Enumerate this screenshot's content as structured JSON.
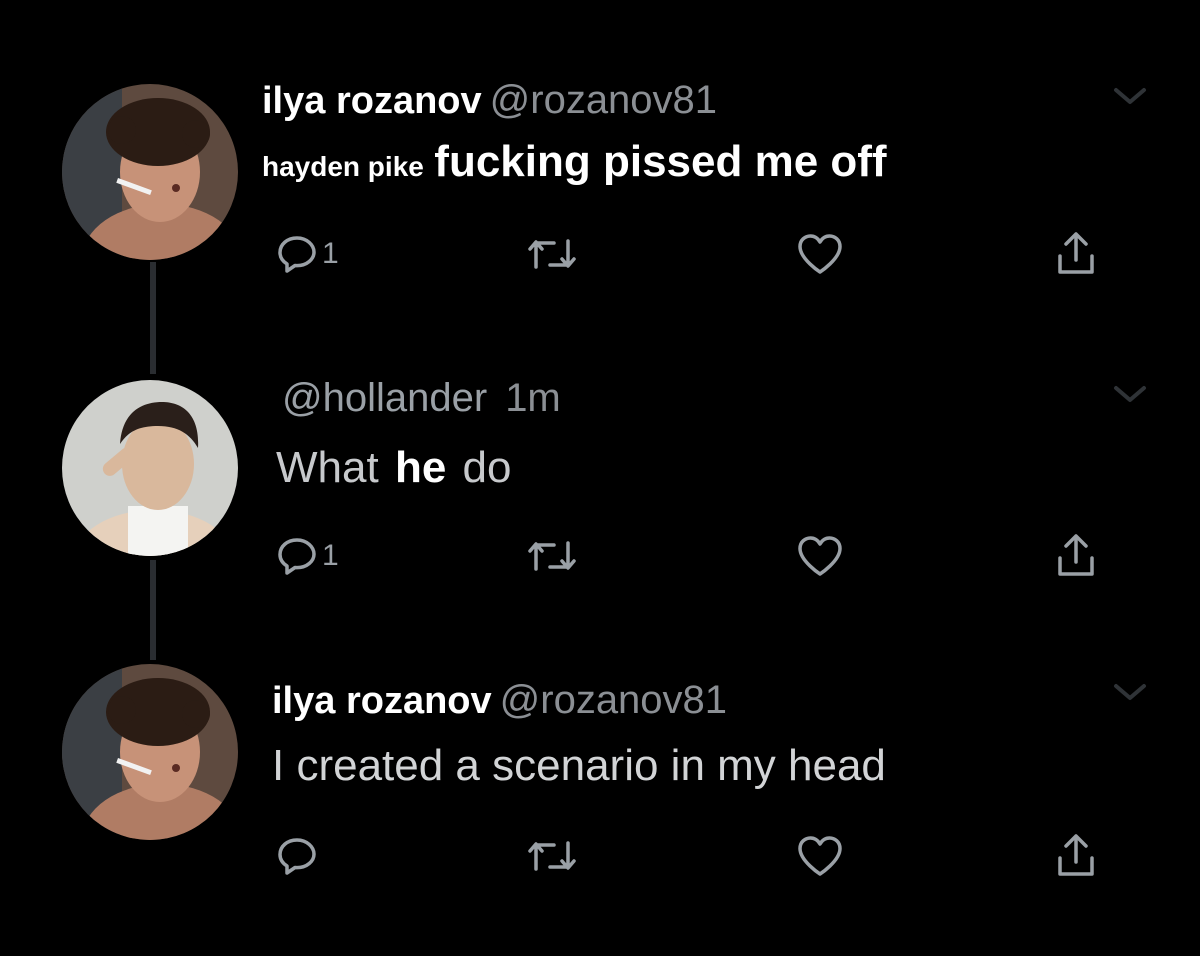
{
  "tweets": [
    {
      "name": "ilya rozanov",
      "handle": "@rozanov81",
      "text_small": "hayden pike",
      "text_big": "fucking pissed me off",
      "reply_count": "1"
    },
    {
      "handle": "@hollander",
      "time": "1m",
      "text_before": "What",
      "text_bold": "he",
      "text_after": "do",
      "reply_count": "1"
    },
    {
      "name": "ilya rozanov",
      "handle": "@rozanov81",
      "text": "I created a scenario in my head",
      "reply_count": ""
    }
  ],
  "icons": {
    "reply": "reply-icon",
    "retweet": "retweet-icon",
    "like": "like-icon",
    "share": "share-icon",
    "caret": "chevron-down-icon"
  },
  "colors": {
    "background": "#000000",
    "icon": "#9aa0a6",
    "name": "#ffffff",
    "handle": "#8b8f94"
  }
}
